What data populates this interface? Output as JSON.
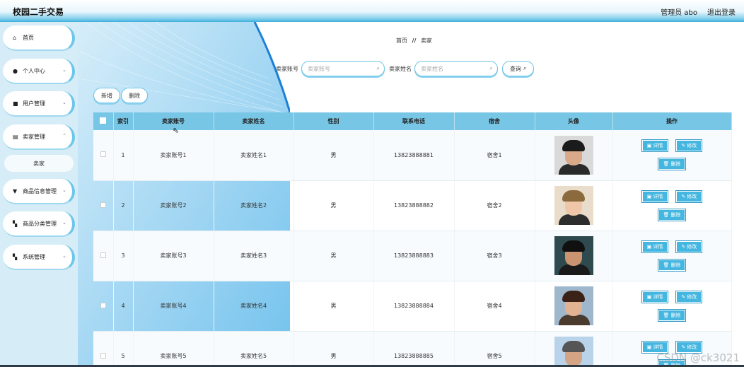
{
  "app": {
    "title": "校园二手交易"
  },
  "topbar": {
    "user": "管理员 abo",
    "logout": "退出登录"
  },
  "sidebar": {
    "items": [
      {
        "label": "首页",
        "icon": "home-icon"
      },
      {
        "label": "个人中心",
        "icon": "user-icon"
      },
      {
        "label": "用户管理",
        "icon": "lock-icon"
      },
      {
        "label": "卖家管理",
        "icon": "doc-icon"
      },
      {
        "label": "商品信息管理",
        "icon": "list-icon"
      },
      {
        "label": "商品分类管理",
        "icon": "grid-icon"
      },
      {
        "label": "系统管理",
        "icon": "grid-icon"
      }
    ],
    "sub_item": "卖家"
  },
  "breadcrumb": {
    "home": "首页",
    "sep": "//",
    "current": "卖家"
  },
  "search": {
    "account_label": "卖家账号",
    "account_placeholder": "卖家账号",
    "name_label": "卖家姓名",
    "name_placeholder": "卖家姓名",
    "query_button": "查询"
  },
  "actions": {
    "add": "新增",
    "delete": "删除"
  },
  "table": {
    "headers": [
      "索引",
      "卖家账号",
      "卖家姓名",
      "性别",
      "联系电话",
      "宿舍",
      "头像",
      "操作"
    ],
    "rows": [
      {
        "index": "1",
        "account": "卖家账号1",
        "name": "卖家姓名1",
        "gender": "男",
        "phone": "13823888881",
        "dorm": "宿舍1"
      },
      {
        "index": "2",
        "account": "卖家账号2",
        "name": "卖家姓名2",
        "gender": "男",
        "phone": "13823888882",
        "dorm": "宿舍2"
      },
      {
        "index": "3",
        "account": "卖家账号3",
        "name": "卖家姓名3",
        "gender": "男",
        "phone": "13823888883",
        "dorm": "宿舍3"
      },
      {
        "index": "4",
        "account": "卖家账号4",
        "name": "卖家姓名4",
        "gender": "男",
        "phone": "13823888884",
        "dorm": "宿舍4"
      },
      {
        "index": "5",
        "account": "卖家账号5",
        "name": "卖家姓名5",
        "gender": "男",
        "phone": "13823888885",
        "dorm": "宿舍5"
      }
    ],
    "op_labels": {
      "detail": "详情",
      "edit": "修改",
      "delete": "删除"
    }
  },
  "watermark": "CSDN @ck3021",
  "colors": {
    "accent": "#44b6e0",
    "header_bg": "#77c6e6",
    "sidebar_bg": "#d6edf7"
  }
}
